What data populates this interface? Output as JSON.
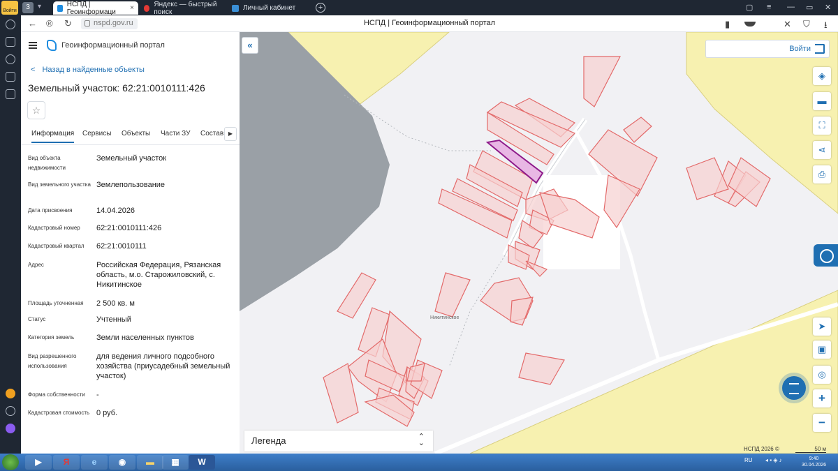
{
  "browser": {
    "login_badge": "Войти",
    "profile_number": "3",
    "tabs": [
      {
        "label": "НСПД | Геоинформаци",
        "active": true
      },
      {
        "label": "Яндекс — быстрый поиск",
        "active": false
      },
      {
        "label": "Личный кабинет",
        "active": false
      }
    ],
    "url": "nspd.gov.ru",
    "page_title": "НСПД | Геоинформационный портал"
  },
  "panel": {
    "app_name": "Геоинформационный портал",
    "back_label": "Назад в найденные объекты",
    "object_title": "Земельный участок: 62:21:0010111:426",
    "tabs": [
      "Информация",
      "Сервисы",
      "Объекты",
      "Части ЗУ",
      "Состав"
    ],
    "properties": [
      {
        "key": "Вид объекта недвижимости",
        "value": "Земельный участок"
      },
      {
        "key": "Вид земельного участка",
        "value": "Землепользование"
      },
      {
        "key": "Дата присвоения",
        "value": "14.04.2026"
      },
      {
        "key": "Кадастровый номер",
        "value": "62:21:0010111:426"
      },
      {
        "key": "Кадастровый квартал",
        "value": "62:21:0010111"
      },
      {
        "key": "Адрес",
        "value": "Российская Федерация, Рязанская область, м.о. Старожиловский, с. Никитинское"
      },
      {
        "key": "Площадь уточненная",
        "value": "2 500 кв. м"
      },
      {
        "key": "Статус",
        "value": "Учтенный"
      },
      {
        "key": "Категория земель",
        "value": "Земли населенных пунктов"
      },
      {
        "key": "Вид разрешенного использования",
        "value": "для ведения личного подсобного хозяйства (приусадебный земельный участок)"
      },
      {
        "key": "Форма собственности",
        "value": "-"
      },
      {
        "key": "Кадастровая стоимость",
        "value": "0 руб."
      }
    ]
  },
  "map": {
    "login_label": "Войти",
    "place_label": "Никитинское",
    "legend_label": "Легенда",
    "copyright": "НСПД 2026 ©",
    "scale_label": "50 м",
    "colors": {
      "parcel_fill": "#f6d0d0",
      "parcel_stroke": "#e36a6a",
      "selected_stroke": "#8e1a8a",
      "field": "#f7f1b0",
      "forest": "#9aa0a6"
    }
  },
  "taskbar": {
    "lang": "RU",
    "time": "9:40",
    "date": "30.04.2026"
  }
}
